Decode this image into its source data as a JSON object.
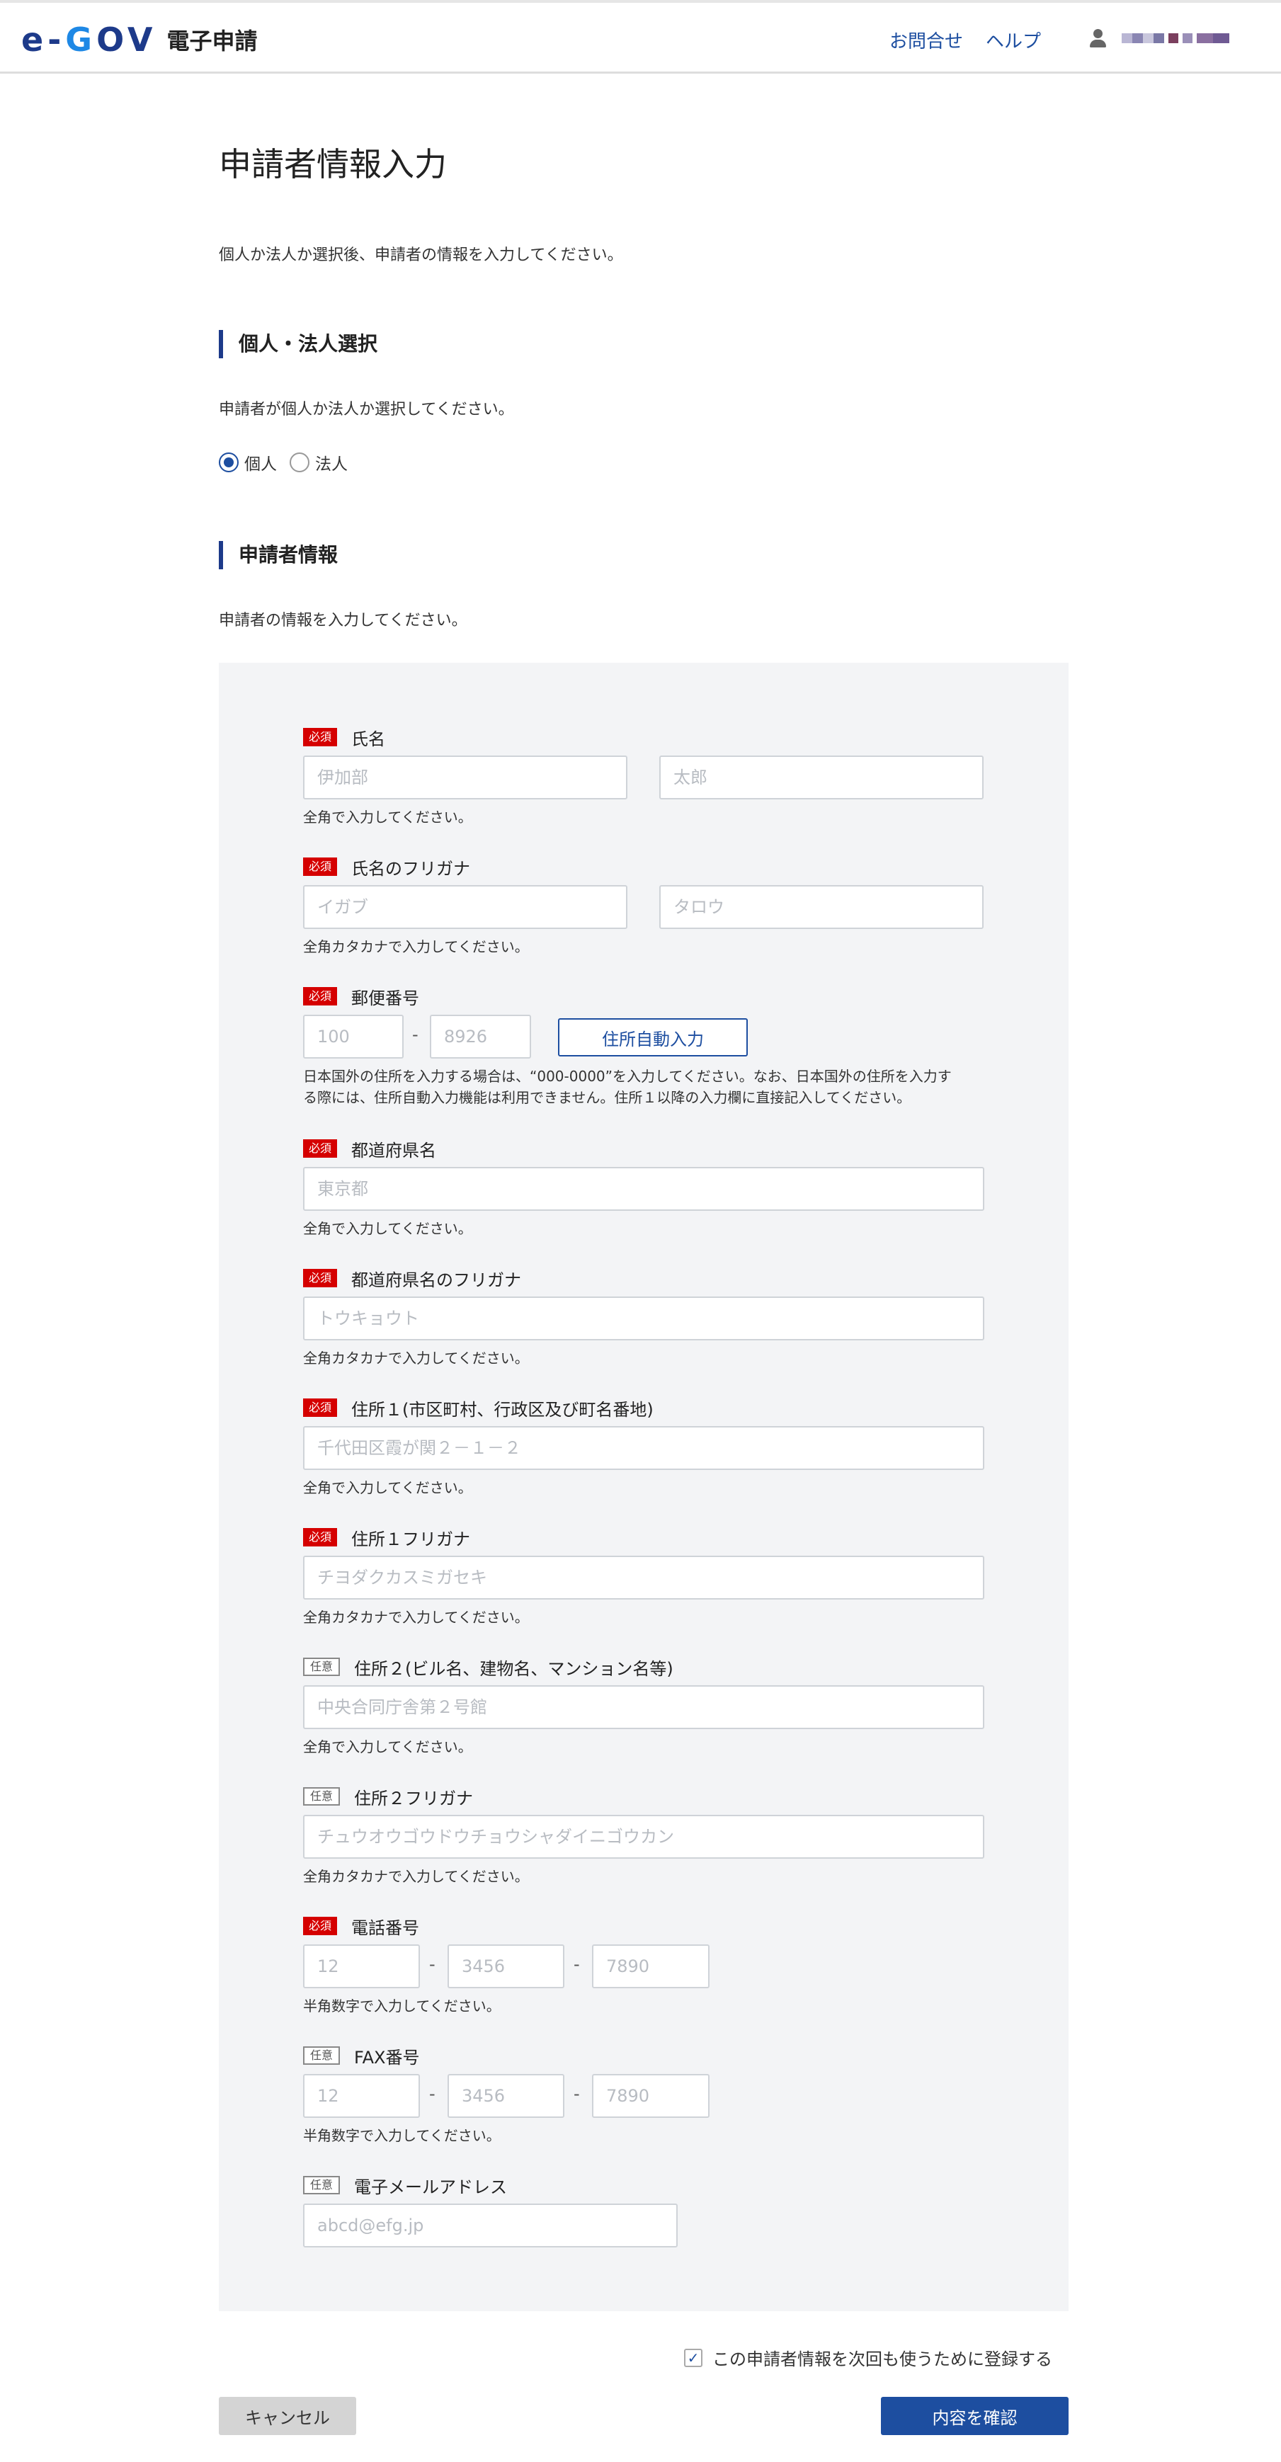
{
  "header": {
    "logo_mark_a": "e-",
    "logo_mark_o": "G",
    "logo_mark_b": "OV",
    "logo_text": "電子申請",
    "contact": "お問合せ",
    "help": "ヘルプ",
    "user_icon": "user-icon"
  },
  "page": {
    "title": "申請者情報入力",
    "lead": "個人か法人か選択後、申請者の情報を入力してください。"
  },
  "section_type": {
    "heading": "個人・法人選択",
    "description": "申請者が個人か法人か選択してください。",
    "options": [
      "個人",
      "法人"
    ],
    "selected": "個人"
  },
  "section_info": {
    "heading": "申請者情報",
    "description": "申請者の情報を入力してください。"
  },
  "badges": {
    "required": "必須",
    "optional": "任意"
  },
  "fields": {
    "name": {
      "label": "氏名",
      "placeholder_last": "伊加部",
      "placeholder_first": "太郎",
      "help": "全角で入力してください。"
    },
    "kana": {
      "label": "氏名のフリガナ",
      "placeholder_last": "イガブ",
      "placeholder_first": "タロウ",
      "help": "全角カタカナで入力してください。"
    },
    "postal": {
      "label": "郵便番号",
      "placeholder_1": "100",
      "placeholder_2": "8926",
      "button": "住所自動入力",
      "help_1": "日本国外の住所を入力する場合は、“000-0000”を入力してください。なお、日本国外の住所を入力す",
      "help_2": "る際には、住所自動入力機能は利用できません。住所１以降の入力欄に直接記入してください。"
    },
    "pref": {
      "label": "都道府県名",
      "placeholder": "東京都",
      "help": "全角で入力してください。"
    },
    "pref_kana": {
      "label": "都道府県名のフリガナ",
      "placeholder": "トウキョウト",
      "help": "全角カタカナで入力してください。"
    },
    "addr1": {
      "label": "住所１(市区町村、行政区及び町名番地)",
      "placeholder": "千代田区霞が関２－１－２",
      "help": "全角で入力してください。"
    },
    "addr1_kana": {
      "label": "住所１フリガナ",
      "placeholder": "チヨダクカスミガセキ",
      "help": "全角カタカナで入力してください。"
    },
    "addr2": {
      "label": "住所２(ビル名、建物名、マンション名等)",
      "placeholder": "中央合同庁舎第２号館",
      "help": "全角で入力してください。"
    },
    "addr2_kana": {
      "label": "住所２フリガナ",
      "placeholder": "チュウオウゴウドウチョウシャダイニゴウカン",
      "help": "全角カタカナで入力してください。"
    },
    "tel": {
      "label": "電話番号",
      "placeholder_1": "12",
      "placeholder_2": "3456",
      "placeholder_3": "7890",
      "help": "半角数字で入力してください。"
    },
    "fax": {
      "label": "FAX番号",
      "placeholder_1": "12",
      "placeholder_2": "3456",
      "placeholder_3": "7890",
      "help": "半角数字で入力してください。"
    },
    "email": {
      "label": "電子メールアドレス",
      "placeholder": "abcd@efg.jp"
    }
  },
  "separator": "-",
  "save_checkbox": {
    "label": "この申請者情報を次回も使うために登録する",
    "checked": true,
    "mark": "✓"
  },
  "buttons": {
    "cancel": "キャンセル",
    "confirm": "内容を確認"
  },
  "colors": {
    "brand": "#1d3a8a",
    "accent": "#1d4ea0",
    "required": "#d50000",
    "panel": "#f3f4f6"
  }
}
